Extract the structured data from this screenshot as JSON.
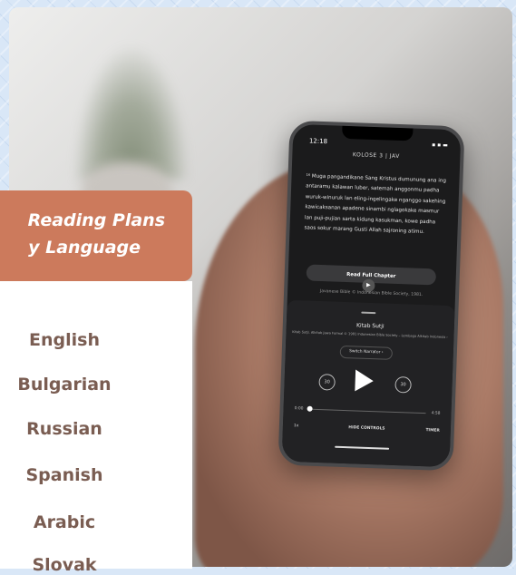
{
  "banner": {
    "line1": "Reading Plans",
    "line2": "y Language"
  },
  "languages": [
    "English",
    "Bulgarian",
    "Russian",
    "Spanish",
    "Arabic",
    "Slovak"
  ],
  "phone": {
    "time": "12:18",
    "status_icons": "▪ ▪ ▬",
    "chapter_title": "KOLOSE 3  |  JAV",
    "verse_text": "¹⁶ Muga pangandikane Sang Kristus dumunung ana ing antaramu kalawan luber, satemah anggonmu padha wuruk-winuruk lan eling-ingelingake nganggo sakehing kawicaksanan apadene sinambi nglagokake masmur lan puji-pujian sarta kidung kasukman, kowe padha saos sokur marang Gusti Allah sajroning atimu.",
    "read_button": "Read Full Chapter",
    "copyright": "Javanese Bible © Indonesian Bible Society, 1981.",
    "player": {
      "book_name": "Kitab Sutji",
      "book_info": "Kitab Sutji, Alkitab Jawa Formal © 1981 Indonesian Bible Society – Lembaga Alkitab Indonesia  ›",
      "switch_narrator": "Switch Narrator  ›",
      "skip_back": "30",
      "skip_forward": "30",
      "time_start": "0:00",
      "time_end": "4:58",
      "speed": "1x",
      "hide_controls": "HIDE CONTROLS",
      "timer": "TIMER"
    }
  },
  "colors": {
    "banner": "#cc7a5c",
    "language_text": "#7a5d52",
    "background": "#d9e7f7"
  }
}
